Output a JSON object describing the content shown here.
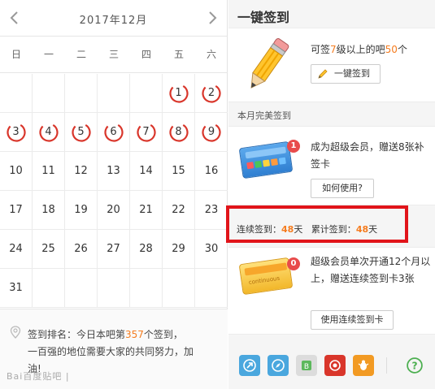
{
  "calendar": {
    "title": "2017年12月",
    "weekdays": [
      "日",
      "一",
      "二",
      "三",
      "四",
      "五",
      "六"
    ],
    "days": [
      "",
      "",
      "",
      "",
      "",
      "1",
      "2",
      "3",
      "4",
      "5",
      "6",
      "7",
      "8",
      "9",
      "10",
      "11",
      "12",
      "13",
      "14",
      "15",
      "16",
      "17",
      "18",
      "19",
      "20",
      "21",
      "22",
      "23",
      "24",
      "25",
      "26",
      "27",
      "28",
      "29",
      "30",
      "31",
      "",
      "",
      "",
      "",
      "",
      ""
    ],
    "signed_days": [
      "1",
      "2",
      "3",
      "4",
      "5",
      "6",
      "7",
      "8",
      "9"
    ]
  },
  "rank": {
    "line1_prefix": "签到排名：今日本吧第",
    "rank_number": "357",
    "line1_suffix": "个签到，",
    "line2": "一百强的地位需要大家的共同努力，加",
    "line3": "油!"
  },
  "watermark": "Bai百度贴吧 |",
  "panel": {
    "title": "一键签到",
    "one_click": {
      "text_prefix": "可签",
      "level": "7",
      "text_middle": "级以上的吧",
      "count": "50",
      "text_suffix": "个",
      "button_label": "一键签到"
    },
    "month_perfect_title": "本月完美签到",
    "makeup_card": {
      "badge": "1",
      "text": "成为超级会员，赠送8张补签卡",
      "button_label": "如何使用?"
    },
    "stats": {
      "continuous_label": "连续签到：",
      "continuous_value": "48",
      "continuous_unit": "天",
      "total_label": "累计签到：",
      "total_value": "48",
      "total_unit": "天"
    },
    "continuous_card": {
      "badge": "0",
      "card_text": "continuous",
      "text": "超级会员单次开通12个月以上，赠送连续签到卡3张",
      "button_label": "使用连续签到卡"
    }
  },
  "colors": {
    "accent_orange": "#f57c1f",
    "ring_red": "#d9362b",
    "highlight_red": "#e1141a",
    "badge_red": "#e84b4b"
  },
  "icons": [
    "share-icon",
    "explore-icon",
    "bbs-icon",
    "badge-icon",
    "bug-icon",
    "help-icon"
  ]
}
